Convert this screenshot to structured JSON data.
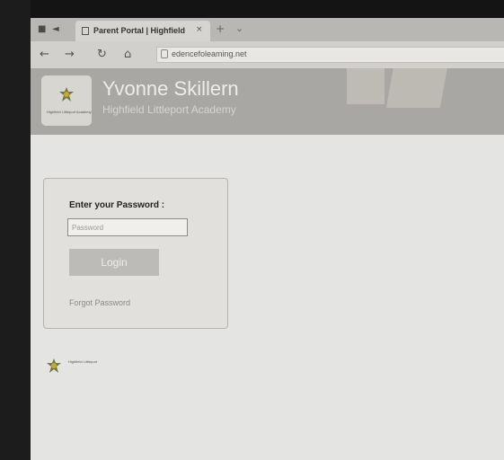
{
  "browser": {
    "tab_title": "Parent Portal | Highfield",
    "close_tab_glyph": "×",
    "new_tab_glyph": "+",
    "tab_menu_glyph": "⌄",
    "nav": {
      "back": "←",
      "forward": "→",
      "refresh": "↻",
      "home": "⌂"
    },
    "url": "edencefoleaming.net"
  },
  "site": {
    "student_name": "Yvonne Skillern",
    "school_name": "Highfield Littleport Academy",
    "logo_caption": "Highfield Littleport Academy"
  },
  "login": {
    "password_label": "Enter your Password :",
    "password_placeholder": "Password",
    "login_button": "Login",
    "forgot_link": "Forgot Password"
  },
  "footer": {
    "text": "Highfield Littleport"
  },
  "colors": {
    "header_bg": "#a8a7a3",
    "page_bg": "#e4e4e2",
    "button_bg": "#bcbbb7",
    "crest_green": "#6f7a3a"
  }
}
